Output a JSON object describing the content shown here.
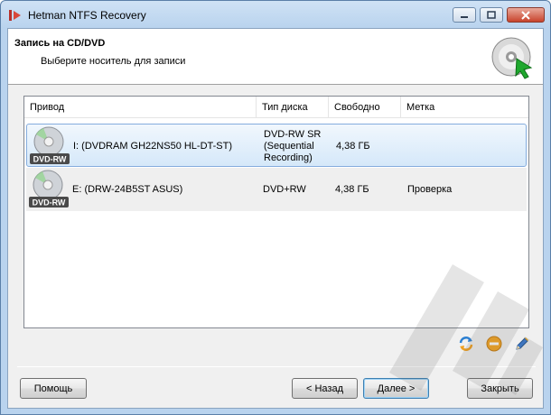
{
  "window": {
    "title": "Hetman NTFS Recovery"
  },
  "header": {
    "title": "Запись на CD/DVD",
    "subtitle": "Выберите носитель для записи"
  },
  "drives": {
    "columns": [
      "Привод",
      "Тип диска",
      "Свободно",
      "Метка"
    ],
    "rows": [
      {
        "icon": "dvd-rw-disc-icon",
        "badge": "DVD-RW",
        "name": "I: (DVDRAM GH22NS50 HL-DT-ST)",
        "type_lines": [
          "DVD-RW SR",
          "(Sequential",
          "Recording)"
        ],
        "free": "4,38 ГБ",
        "label": "",
        "selected": true
      },
      {
        "icon": "dvd-rw-disc-icon",
        "badge": "DVD-RW",
        "name": "E: (DRW-24B5ST ASUS)",
        "type_lines": [
          "DVD+RW"
        ],
        "free": "4,38 ГБ",
        "label": "Проверка",
        "selected": false
      }
    ]
  },
  "toolbar": {
    "icons": [
      "refresh-icon",
      "erase-icon",
      "edit-icon"
    ]
  },
  "buttons": {
    "help": "Помощь",
    "back": "< Назад",
    "next": "Далее >",
    "close": "Закрыть"
  },
  "colors": {
    "selection": "#d5e8f9",
    "selection_border": "#84acdd",
    "accent_green": "#1fa82e"
  }
}
